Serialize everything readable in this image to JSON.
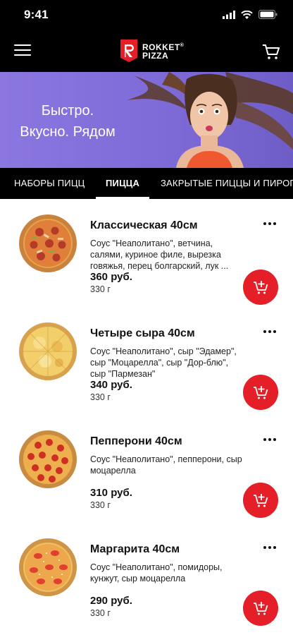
{
  "status_bar": {
    "time": "9:41"
  },
  "header": {
    "logo_line1": "ROKKET",
    "logo_line2": "PIZZA",
    "logo_mark": "®"
  },
  "banner": {
    "line1": "Быстро.",
    "line2": "Вкусно. Рядом"
  },
  "tabs": [
    {
      "label": "НАБОРЫ ПИЦЦ",
      "active": false
    },
    {
      "label": "ПИЦЦА",
      "active": true
    },
    {
      "label": "ЗАКРЫТЫЕ ПИЦЦЫ И ПИРОГИ",
      "active": false
    }
  ],
  "products": [
    {
      "name": "Классическая 40см",
      "description": "Соус \"Неаполитано\", ветчина, салями, куриное филе, вырезка говяжья, перец болгарский, лук ...",
      "price": "360 руб.",
      "weight": "330 г",
      "style": "classic"
    },
    {
      "name": "Четыре сыра 40см",
      "description": "Соус \"Неаполитано\", сыр \"Эдамер\", сыр \"Моцарелла\", сыр \"Дор-блю\", сыр \"Пармезан\"",
      "price": "340 руб.",
      "weight": "330 г",
      "style": "cheese"
    },
    {
      "name": "Пепперони 40см",
      "description": "Соус \"Неаполитано\", пепперони, сыр моцарелла",
      "price": "310 руб.",
      "weight": "330 г",
      "style": "pepperoni"
    },
    {
      "name": "Маргарита 40см",
      "description": "Соус \"Неаполитано\", помидоры, кунжут, сыр моцарелла",
      "price": "290 руб.",
      "weight": "330 г",
      "style": "margherita"
    }
  ],
  "icons": {
    "menu": "hamburger-menu-icon",
    "cart": "cart-icon",
    "more": "more-dots-icon",
    "add": "add-to-cart-icon"
  },
  "colors": {
    "accent_red": "#e41f28",
    "banner_purple": "#7e6bd8",
    "header_black": "#000000"
  }
}
